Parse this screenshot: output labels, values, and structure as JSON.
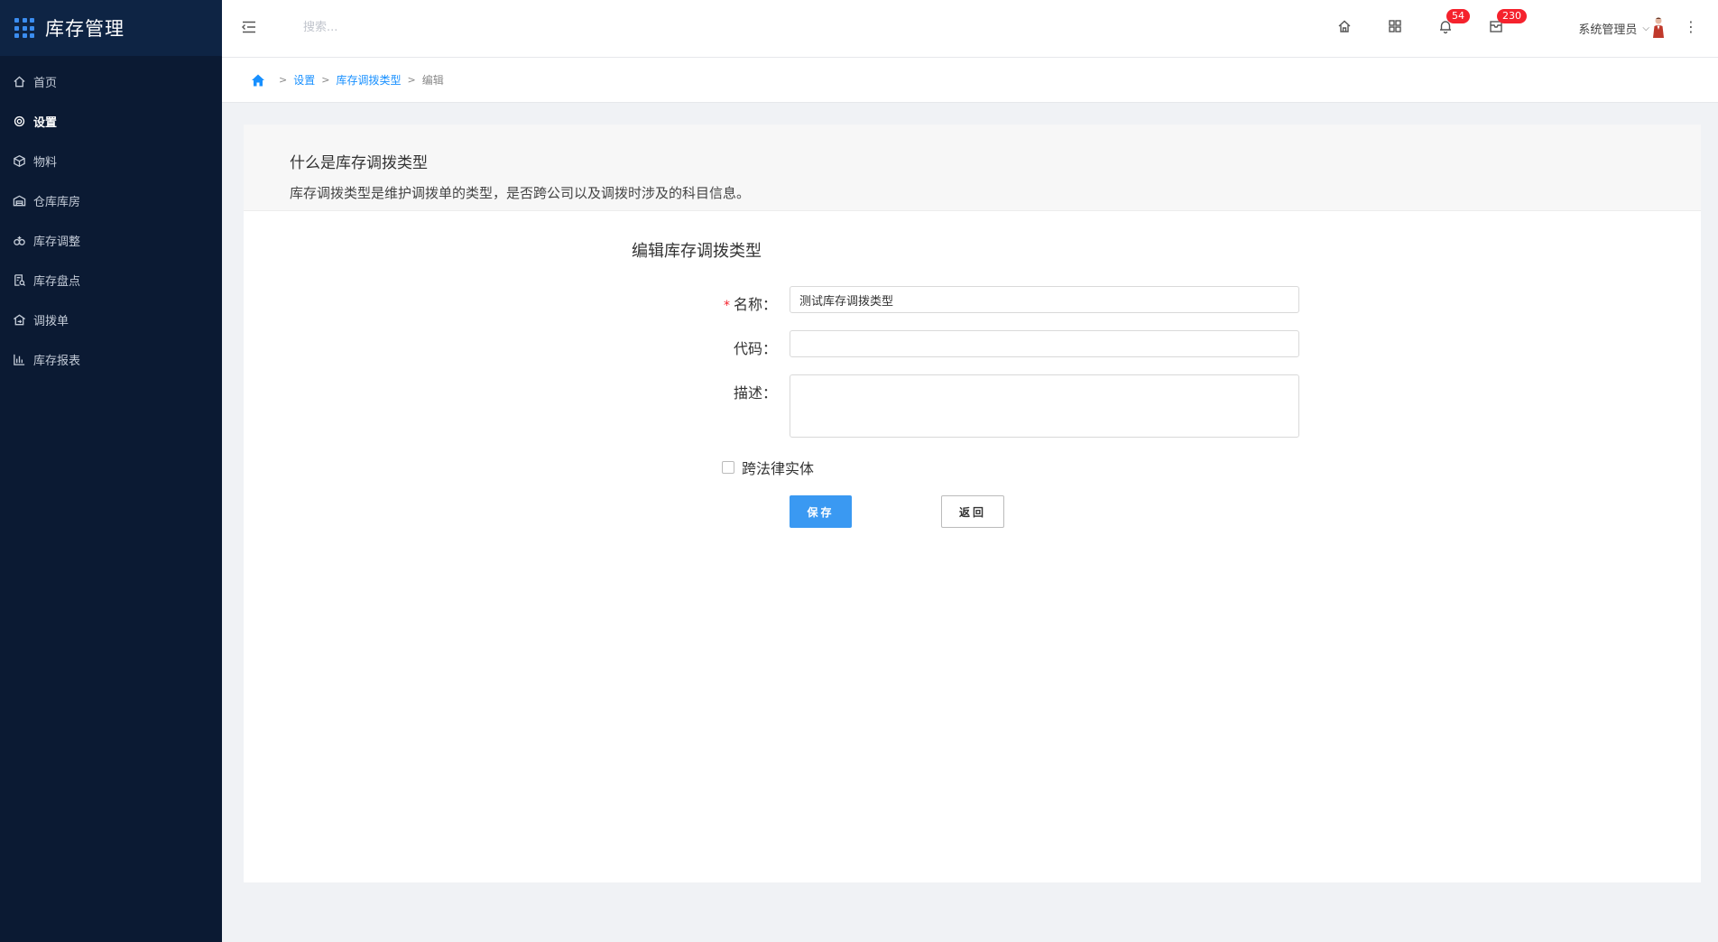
{
  "app": {
    "title": "库存管理"
  },
  "sidebar": {
    "items": [
      {
        "label": "首页",
        "icon": "home-icon",
        "active": false
      },
      {
        "label": "设置",
        "icon": "gear-icon",
        "active": true
      },
      {
        "label": "物料",
        "icon": "cube-icon",
        "active": false
      },
      {
        "label": "仓库库房",
        "icon": "warehouse-icon",
        "active": false
      },
      {
        "label": "库存调整",
        "icon": "adjust-icon",
        "active": false
      },
      {
        "label": "库存盘点",
        "icon": "inventory-check-icon",
        "active": false
      },
      {
        "label": "调拨单",
        "icon": "transfer-icon",
        "active": false
      },
      {
        "label": "库存报表",
        "icon": "bar-chart-icon",
        "active": false
      }
    ]
  },
  "topbar": {
    "search_placeholder": "搜索...",
    "notifications_count": "54",
    "messages_count": "230",
    "user_name": "系统管理员"
  },
  "breadcrumb": {
    "items": [
      "设置",
      "库存调拨类型"
    ],
    "current": "编辑"
  },
  "intro": {
    "title": "什么是库存调拨类型",
    "description": "库存调拨类型是维护调拨单的类型，是否跨公司以及调拨时涉及的科目信息。"
  },
  "form": {
    "title": "编辑库存调拨类型",
    "name_label": "名称：",
    "name_value": "测试库存调拨类型",
    "code_label": "代码：",
    "code_value": "",
    "desc_label": "描述：",
    "desc_value": "",
    "cross_entity_label": "跨法律实体",
    "cross_entity_checked": false,
    "save_label": "保存",
    "back_label": "返回"
  },
  "colors": {
    "sidebar_bg": "#0b1a33",
    "accent": "#1890ff",
    "save_button": "#3a99f2",
    "badge": "#f5222d"
  }
}
